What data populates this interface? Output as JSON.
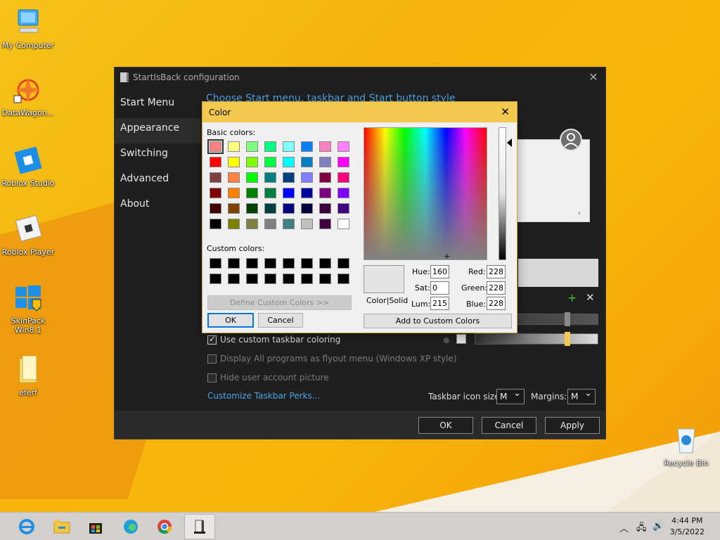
{
  "desktop": {
    "icons": [
      {
        "label": "My Computer",
        "icon": "computer-icon"
      },
      {
        "label": "DataWagon...",
        "icon": "datawagon-icon"
      },
      {
        "label": "Roblox Studio",
        "icon": "roblox-studio-icon"
      },
      {
        "label": "Roblox Player",
        "icon": "roblox-player-icon"
      },
      {
        "label": "SkinPack Win8.1",
        "icon": "windows-shield-icon"
      },
      {
        "label": "eferf",
        "icon": "folder-icon"
      },
      {
        "label": "Recycle Bin",
        "icon": "recycle-bin-icon"
      }
    ]
  },
  "window": {
    "title": "StartIsBack configuration",
    "nav": [
      "Start Menu",
      "Appearance",
      "Switching",
      "Advanced",
      "About"
    ],
    "active_nav": "Appearance",
    "heading": "Choose Start menu, taskbar and Start button style",
    "options": [
      {
        "label": "Use custom taskbar coloring",
        "checked": true,
        "enabled": true
      },
      {
        "label": "Display All programs as flyout menu (Windows XP style)",
        "checked": false,
        "enabled": false
      },
      {
        "label": "Hide user account picture",
        "checked": false,
        "enabled": false
      }
    ],
    "customize_link": "Customize Taskbar Perks...",
    "taskbar_icon_size_label": "Taskbar icon size:",
    "taskbar_icon_size_value": "M",
    "margins_label": "Margins:",
    "margins_value": "M",
    "buttons": {
      "ok": "OK",
      "cancel": "Cancel",
      "apply": "Apply"
    },
    "accent_colors": {
      "link": "#4aa3e6",
      "slider_thumb": "#f2c94e"
    }
  },
  "color_dialog": {
    "title": "Color",
    "basic_colors_label": "Basic colors:",
    "custom_colors_label": "Custom colors:",
    "basic_colors": [
      "#ff8080",
      "#ffff80",
      "#80ff80",
      "#00ff80",
      "#80ffff",
      "#0080ff",
      "#ff80c0",
      "#ff80ff",
      "#ff0000",
      "#ffff00",
      "#80ff00",
      "#00ff40",
      "#00ffff",
      "#0080c0",
      "#8080c0",
      "#ff00ff",
      "#804040",
      "#ff8040",
      "#00ff00",
      "#008080",
      "#004080",
      "#8080ff",
      "#800040",
      "#ff0080",
      "#800000",
      "#ff8000",
      "#008000",
      "#008040",
      "#0000ff",
      "#0000a0",
      "#800080",
      "#8000ff",
      "#400000",
      "#804000",
      "#004000",
      "#004040",
      "#000080",
      "#000040",
      "#400040",
      "#400080",
      "#000000",
      "#808000",
      "#808040",
      "#808080",
      "#408080",
      "#c0c0c0",
      "#400040",
      "#ffffff"
    ],
    "custom_colors": [
      "#000000",
      "#000000",
      "#000000",
      "#000000",
      "#000000",
      "#000000",
      "#000000",
      "#000000",
      "#000000",
      "#000000",
      "#000000",
      "#000000",
      "#000000",
      "#000000",
      "#000000",
      "#000000"
    ],
    "define_custom_label": "Define Custom Colors >>",
    "ok": "OK",
    "cancel": "Cancel",
    "color_solid_label": "Color|Solid",
    "hue_label": "Hue:",
    "hue": "160",
    "sat_label": "Sat:",
    "sat": "0",
    "lum_label": "Lum:",
    "lum": "215",
    "red_label": "Red:",
    "red": "228",
    "green_label": "Green:",
    "green": "228",
    "blue_label": "Blue:",
    "blue": "228",
    "add_custom_label": "Add to Custom Colors"
  },
  "taskbar": {
    "apps": [
      {
        "name": "internet-explorer-icon",
        "active": false
      },
      {
        "name": "file-explorer-icon",
        "active": false
      },
      {
        "name": "store-icon",
        "active": false
      },
      {
        "name": "edge-icon",
        "active": false
      },
      {
        "name": "chrome-icon",
        "active": false
      },
      {
        "name": "startisback-icon",
        "active": true
      }
    ],
    "time": "4:44 PM",
    "date": "3/5/2022"
  }
}
